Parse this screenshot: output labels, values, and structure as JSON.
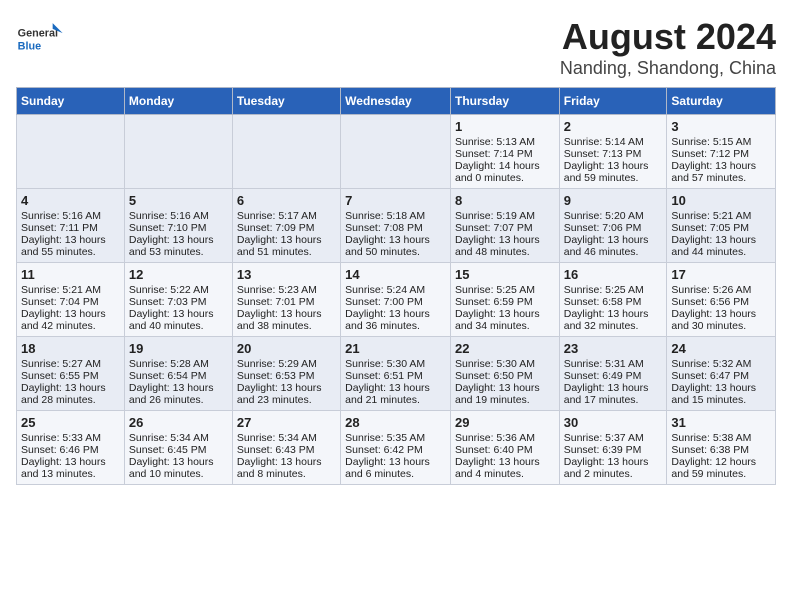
{
  "logo": {
    "general": "General",
    "blue": "Blue"
  },
  "title": "August 2024",
  "subtitle": "Nanding, Shandong, China",
  "headers": [
    "Sunday",
    "Monday",
    "Tuesday",
    "Wednesday",
    "Thursday",
    "Friday",
    "Saturday"
  ],
  "weeks": [
    [
      {
        "day": "",
        "content": ""
      },
      {
        "day": "",
        "content": ""
      },
      {
        "day": "",
        "content": ""
      },
      {
        "day": "",
        "content": ""
      },
      {
        "day": "1",
        "content": "Sunrise: 5:13 AM\nSunset: 7:14 PM\nDaylight: 14 hours\nand 0 minutes."
      },
      {
        "day": "2",
        "content": "Sunrise: 5:14 AM\nSunset: 7:13 PM\nDaylight: 13 hours\nand 59 minutes."
      },
      {
        "day": "3",
        "content": "Sunrise: 5:15 AM\nSunset: 7:12 PM\nDaylight: 13 hours\nand 57 minutes."
      }
    ],
    [
      {
        "day": "4",
        "content": "Sunrise: 5:16 AM\nSunset: 7:11 PM\nDaylight: 13 hours\nand 55 minutes."
      },
      {
        "day": "5",
        "content": "Sunrise: 5:16 AM\nSunset: 7:10 PM\nDaylight: 13 hours\nand 53 minutes."
      },
      {
        "day": "6",
        "content": "Sunrise: 5:17 AM\nSunset: 7:09 PM\nDaylight: 13 hours\nand 51 minutes."
      },
      {
        "day": "7",
        "content": "Sunrise: 5:18 AM\nSunset: 7:08 PM\nDaylight: 13 hours\nand 50 minutes."
      },
      {
        "day": "8",
        "content": "Sunrise: 5:19 AM\nSunset: 7:07 PM\nDaylight: 13 hours\nand 48 minutes."
      },
      {
        "day": "9",
        "content": "Sunrise: 5:20 AM\nSunset: 7:06 PM\nDaylight: 13 hours\nand 46 minutes."
      },
      {
        "day": "10",
        "content": "Sunrise: 5:21 AM\nSunset: 7:05 PM\nDaylight: 13 hours\nand 44 minutes."
      }
    ],
    [
      {
        "day": "11",
        "content": "Sunrise: 5:21 AM\nSunset: 7:04 PM\nDaylight: 13 hours\nand 42 minutes."
      },
      {
        "day": "12",
        "content": "Sunrise: 5:22 AM\nSunset: 7:03 PM\nDaylight: 13 hours\nand 40 minutes."
      },
      {
        "day": "13",
        "content": "Sunrise: 5:23 AM\nSunset: 7:01 PM\nDaylight: 13 hours\nand 38 minutes."
      },
      {
        "day": "14",
        "content": "Sunrise: 5:24 AM\nSunset: 7:00 PM\nDaylight: 13 hours\nand 36 minutes."
      },
      {
        "day": "15",
        "content": "Sunrise: 5:25 AM\nSunset: 6:59 PM\nDaylight: 13 hours\nand 34 minutes."
      },
      {
        "day": "16",
        "content": "Sunrise: 5:25 AM\nSunset: 6:58 PM\nDaylight: 13 hours\nand 32 minutes."
      },
      {
        "day": "17",
        "content": "Sunrise: 5:26 AM\nSunset: 6:56 PM\nDaylight: 13 hours\nand 30 minutes."
      }
    ],
    [
      {
        "day": "18",
        "content": "Sunrise: 5:27 AM\nSunset: 6:55 PM\nDaylight: 13 hours\nand 28 minutes."
      },
      {
        "day": "19",
        "content": "Sunrise: 5:28 AM\nSunset: 6:54 PM\nDaylight: 13 hours\nand 26 minutes."
      },
      {
        "day": "20",
        "content": "Sunrise: 5:29 AM\nSunset: 6:53 PM\nDaylight: 13 hours\nand 23 minutes."
      },
      {
        "day": "21",
        "content": "Sunrise: 5:30 AM\nSunset: 6:51 PM\nDaylight: 13 hours\nand 21 minutes."
      },
      {
        "day": "22",
        "content": "Sunrise: 5:30 AM\nSunset: 6:50 PM\nDaylight: 13 hours\nand 19 minutes."
      },
      {
        "day": "23",
        "content": "Sunrise: 5:31 AM\nSunset: 6:49 PM\nDaylight: 13 hours\nand 17 minutes."
      },
      {
        "day": "24",
        "content": "Sunrise: 5:32 AM\nSunset: 6:47 PM\nDaylight: 13 hours\nand 15 minutes."
      }
    ],
    [
      {
        "day": "25",
        "content": "Sunrise: 5:33 AM\nSunset: 6:46 PM\nDaylight: 13 hours\nand 13 minutes."
      },
      {
        "day": "26",
        "content": "Sunrise: 5:34 AM\nSunset: 6:45 PM\nDaylight: 13 hours\nand 10 minutes."
      },
      {
        "day": "27",
        "content": "Sunrise: 5:34 AM\nSunset: 6:43 PM\nDaylight: 13 hours\nand 8 minutes."
      },
      {
        "day": "28",
        "content": "Sunrise: 5:35 AM\nSunset: 6:42 PM\nDaylight: 13 hours\nand 6 minutes."
      },
      {
        "day": "29",
        "content": "Sunrise: 5:36 AM\nSunset: 6:40 PM\nDaylight: 13 hours\nand 4 minutes."
      },
      {
        "day": "30",
        "content": "Sunrise: 5:37 AM\nSunset: 6:39 PM\nDaylight: 13 hours\nand 2 minutes."
      },
      {
        "day": "31",
        "content": "Sunrise: 5:38 AM\nSunset: 6:38 PM\nDaylight: 12 hours\nand 59 minutes."
      }
    ]
  ]
}
